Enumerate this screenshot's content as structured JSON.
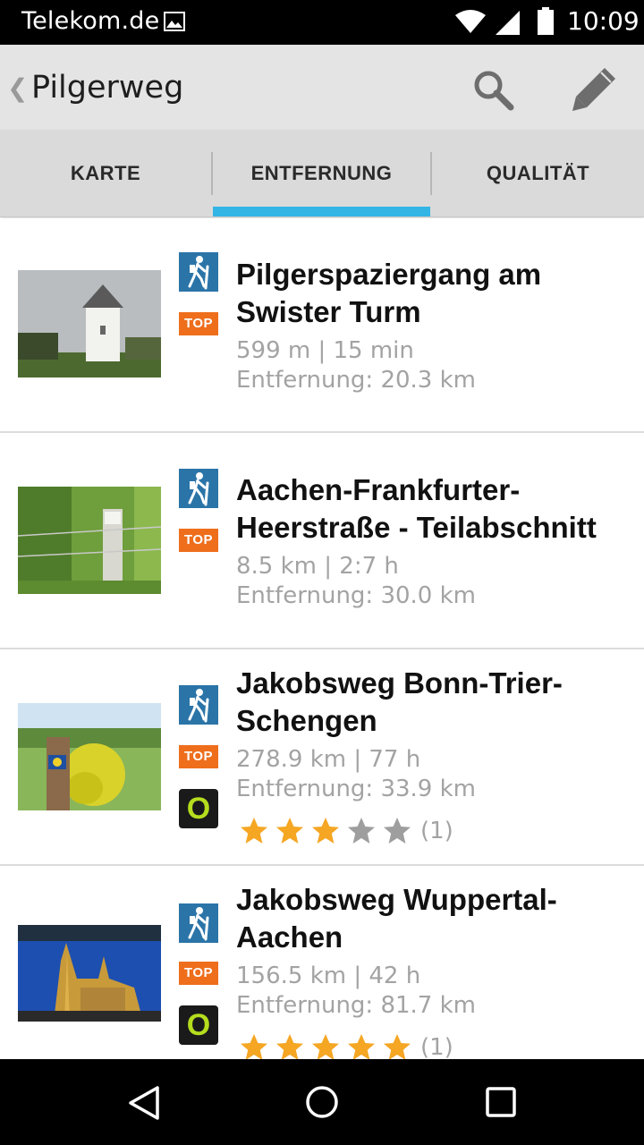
{
  "status_bar": {
    "carrier": "Telekom.de",
    "time": "10:09"
  },
  "action_bar": {
    "title": "Pilgerweg"
  },
  "tabs": [
    {
      "label": "KARTE",
      "selected": false
    },
    {
      "label": "ENTFERNUNG",
      "selected": true
    },
    {
      "label": "QUALITÄT",
      "selected": false
    }
  ],
  "colors": {
    "accent": "#33b5e5",
    "hike_badge": "#2a74a8",
    "top_badge": "#ee6e1c",
    "star_filled": "#f5a623",
    "star_empty": "#9e9e9e"
  },
  "list": {
    "items": [
      {
        "title_line1": "Pilgerspaziergang am",
        "title_line2": "Swister Turm",
        "stats": "599 m | 15 min",
        "distance": "Entfernung:  20.3 km",
        "top_label": "TOP",
        "category_icon": "hiking-icon"
      },
      {
        "title_line1": "Aachen-Frankfurter-",
        "title_line2": "Heerstraße - Teilabschnitt",
        "stats": "8.5 km | 2:7 h",
        "distance": "Entfernung:  30.0 km",
        "top_label": "TOP",
        "category_icon": "hiking-icon"
      },
      {
        "title_line1": "Jakobsweg Bonn-Trier-",
        "title_line2": "Schengen",
        "stats": "278.9 km | 77 h",
        "distance": "Entfernung:  33.9 km",
        "top_label": "TOP",
        "badge_o": "O",
        "rating": 3,
        "rating_max": 5,
        "rating_count": "(1)",
        "category_icon": "hiking-icon"
      },
      {
        "title_line1": "Jakobsweg Wuppertal-",
        "title_line2": "Aachen",
        "stats": "156.5 km | 42 h",
        "distance": "Entfernung:  81.7 km",
        "top_label": "TOP",
        "badge_o": "O",
        "rating": 5,
        "rating_max": 5,
        "rating_count": "(1)",
        "category_icon": "hiking-icon"
      }
    ]
  }
}
